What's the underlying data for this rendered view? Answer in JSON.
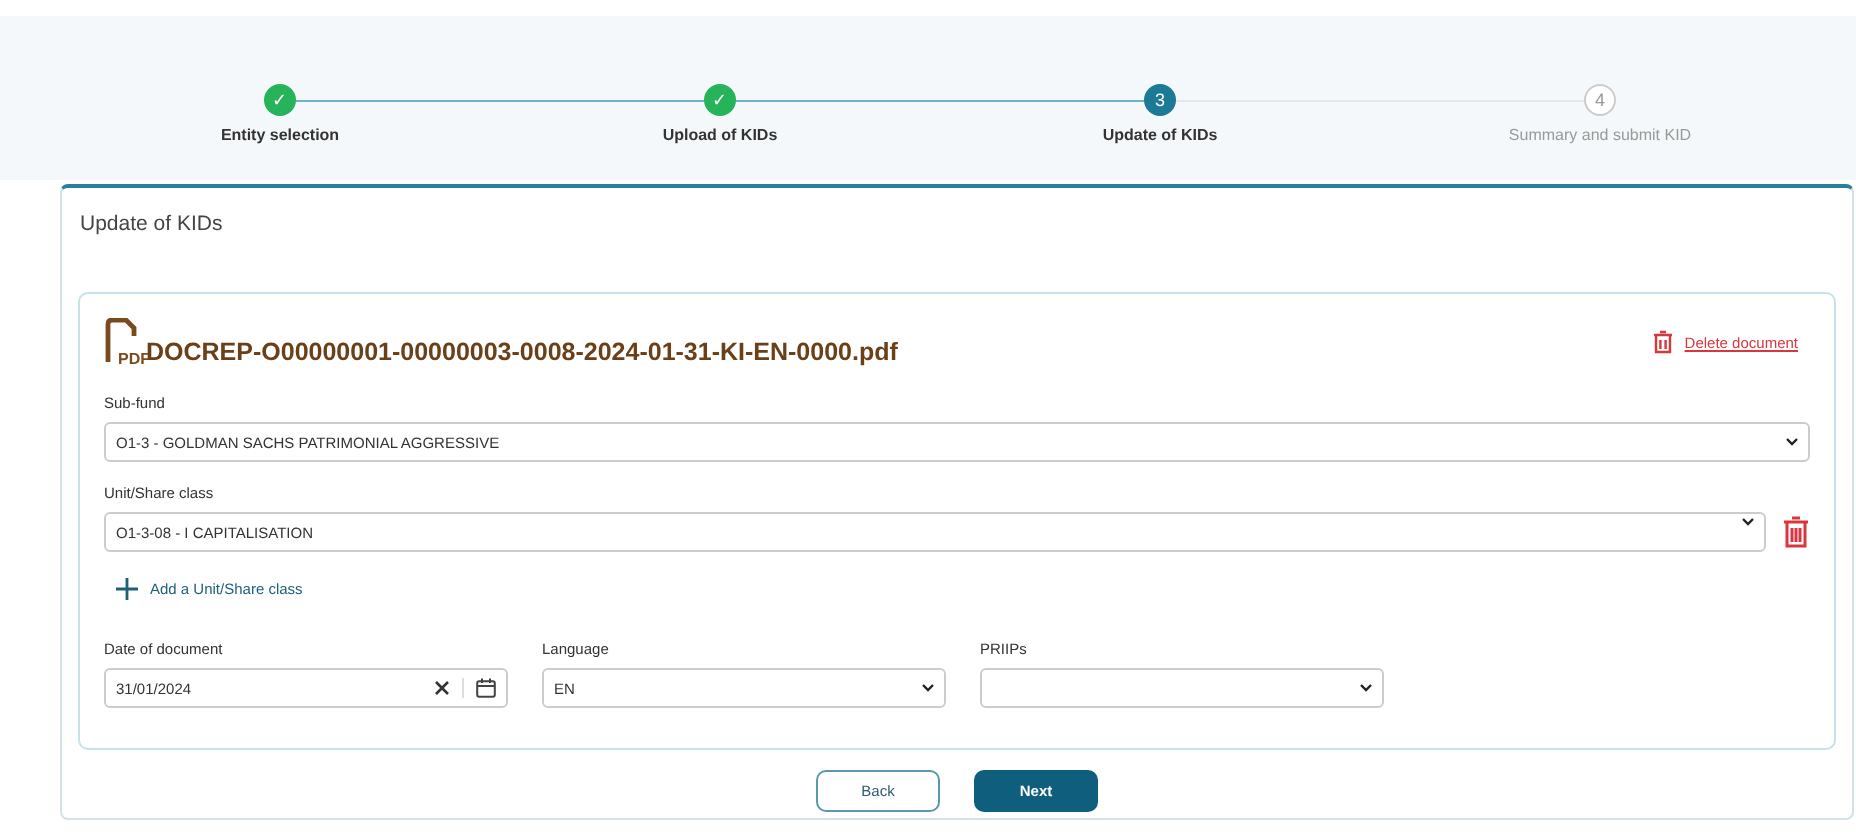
{
  "stepper": [
    {
      "label": "Entity selection",
      "kind": "done",
      "marker": "✓"
    },
    {
      "label": "Upload of KIDs",
      "kind": "done",
      "marker": "✓"
    },
    {
      "label": "Update of KIDs",
      "kind": "current",
      "marker": "3"
    },
    {
      "label": "Summary and submit KID",
      "kind": "pending",
      "marker": "4"
    }
  ],
  "panel": {
    "title": "Update of KIDs",
    "document": {
      "file_name": "DOCREP-O00000001-00000003-0008-2024-01-31-KI-EN-0000.pdf",
      "file_type": "PDF",
      "delete_link": "Delete document",
      "sub_fund": {
        "label": "Sub-fund",
        "value": "O1-3 - GOLDMAN SACHS PATRIMONIAL AGGRESSIVE"
      },
      "unit_share_class": {
        "label": "Unit/Share class",
        "value": "O1-3-08 - I CAPITALISATION"
      },
      "add_link": "Add a Unit/Share class",
      "date": {
        "label": "Date of document",
        "value": "31/01/2024"
      },
      "language": {
        "label": "Language",
        "value": "EN"
      },
      "priips": {
        "label": "PRIIPs"
      }
    },
    "buttons": [
      {
        "label": "Back",
        "kind": "secondary"
      },
      {
        "label": "Next",
        "kind": "primary"
      }
    ]
  }
}
